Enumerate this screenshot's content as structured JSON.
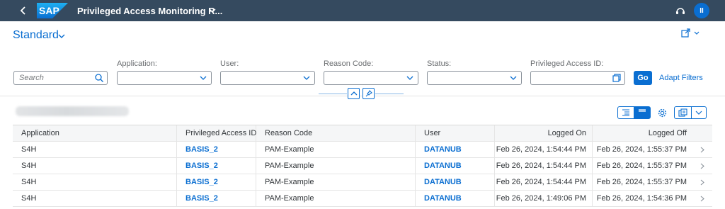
{
  "shell": {
    "logo_text": "SAP",
    "app_title": "Privileged Access Monitoring R...",
    "avatar_initials": "II",
    "colors": {
      "bar": "#354a5f",
      "brand": "#0a6ed1"
    }
  },
  "header": {
    "variant_name": "Standard",
    "filters": {
      "search_placeholder": "Search",
      "application_label": "Application:",
      "user_label": "User:",
      "reason_code_label": "Reason Code:",
      "status_label": "Status:",
      "privileged_access_id_label": "Privileged Access ID:"
    },
    "go_label": "Go",
    "adapt_filters_label": "Adapt Filters"
  },
  "table": {
    "columns": [
      "Application",
      "Privileged Access ID",
      "Reason Code",
      "User",
      "Logged On",
      "Logged Off"
    ],
    "rows": [
      {
        "application": "S4H",
        "privileged_access_id": "BASIS_2",
        "reason_code": "PAM-Example",
        "user": "DATANUB",
        "logged_on": "Feb 26, 2024, 1:54:44 PM",
        "logged_off": "Feb 26, 2024, 1:55:37 PM"
      },
      {
        "application": "S4H",
        "privileged_access_id": "BASIS_2",
        "reason_code": "PAM-Example",
        "user": "DATANUB",
        "logged_on": "Feb 26, 2024, 1:54:44 PM",
        "logged_off": "Feb 26, 2024, 1:55:37 PM"
      },
      {
        "application": "S4H",
        "privileged_access_id": "BASIS_2",
        "reason_code": "PAM-Example",
        "user": "DATANUB",
        "logged_on": "Feb 26, 2024, 1:54:44 PM",
        "logged_off": "Feb 26, 2024, 1:55:37 PM"
      },
      {
        "application": "S4H",
        "privileged_access_id": "BASIS_2",
        "reason_code": "PAM-Example",
        "user": "DATANUB",
        "logged_on": "Feb 26, 2024, 1:49:06 PM",
        "logged_off": "Feb 26, 2024, 1:54:36 PM"
      }
    ]
  },
  "icons": [
    "back-icon",
    "chevron-down-icon",
    "help-icon",
    "share-icon",
    "search-icon",
    "value-help-icon",
    "collapse-header-icon",
    "pin-header-icon",
    "settings-icon",
    "export-icon",
    "navigation-arrow-icon"
  ]
}
